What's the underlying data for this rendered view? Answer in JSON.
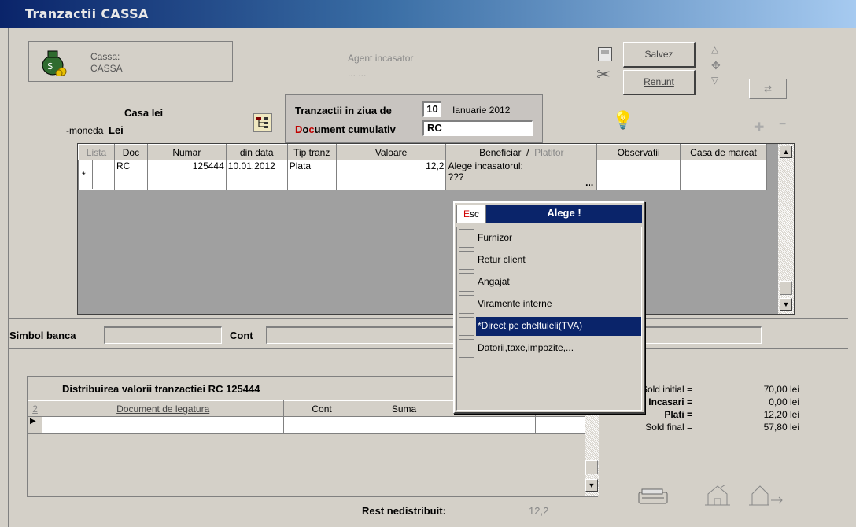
{
  "window": {
    "title": "Tranzactii CASSA"
  },
  "cassa": {
    "label": "Cassa:",
    "value": "CASSA",
    "agent_label": "Agent incasator",
    "agent_value": "... ..."
  },
  "buttons": {
    "salvez": "Salvez",
    "renunt": "Renunt"
  },
  "casa": {
    "title": "Casa lei",
    "moneda_label": "-moneda",
    "moneda_value": "Lei"
  },
  "tranz": {
    "label": "Tranzactii in ziua de",
    "day": "10",
    "month": "Ianuarie 2012",
    "doc_label": "Document cumulativ",
    "doc_value": "RC"
  },
  "grid": {
    "columns": [
      "Lista",
      "Doc",
      "Numar",
      "din data",
      "Tip tranz",
      "Valoare",
      "Beneficiar",
      "/",
      "Platitor",
      "Observatii",
      "Casa de marcat"
    ],
    "row": {
      "marker": "*",
      "doc": "RC",
      "numar": "125444",
      "data": "10.01.2012",
      "tip": "Plata",
      "valoare": "12,2",
      "beneficiar1": "Alege incasatorul:",
      "beneficiar2": "???",
      "ellipsis": "..."
    }
  },
  "popup": {
    "esc": "Esc",
    "title": "Alege !",
    "items": [
      "Furnizor",
      "Retur client",
      "Angajat",
      "Viramente interne",
      "*Direct pe cheltuieli(TVA)",
      "Datorii,taxe,impozite,..."
    ]
  },
  "bank": {
    "simbol_label": "Simbol banca",
    "cont_label": "Cont"
  },
  "distrib": {
    "title": "Distribuirea valorii tranzactiei RC  125444",
    "columns": [
      "2",
      "Document de legatura",
      "Cont",
      "Suma"
    ],
    "rest_label": "Rest nedistribuit:",
    "rest_value": "12,2"
  },
  "totals": [
    {
      "label": "Sold initial =",
      "value": "70,00 lei"
    },
    {
      "label": "Incasari =",
      "value": "0,00 lei"
    },
    {
      "label": "Plati =",
      "value": "12,20 lei"
    },
    {
      "label": "Sold final =",
      "value": "57,80 lei"
    }
  ]
}
